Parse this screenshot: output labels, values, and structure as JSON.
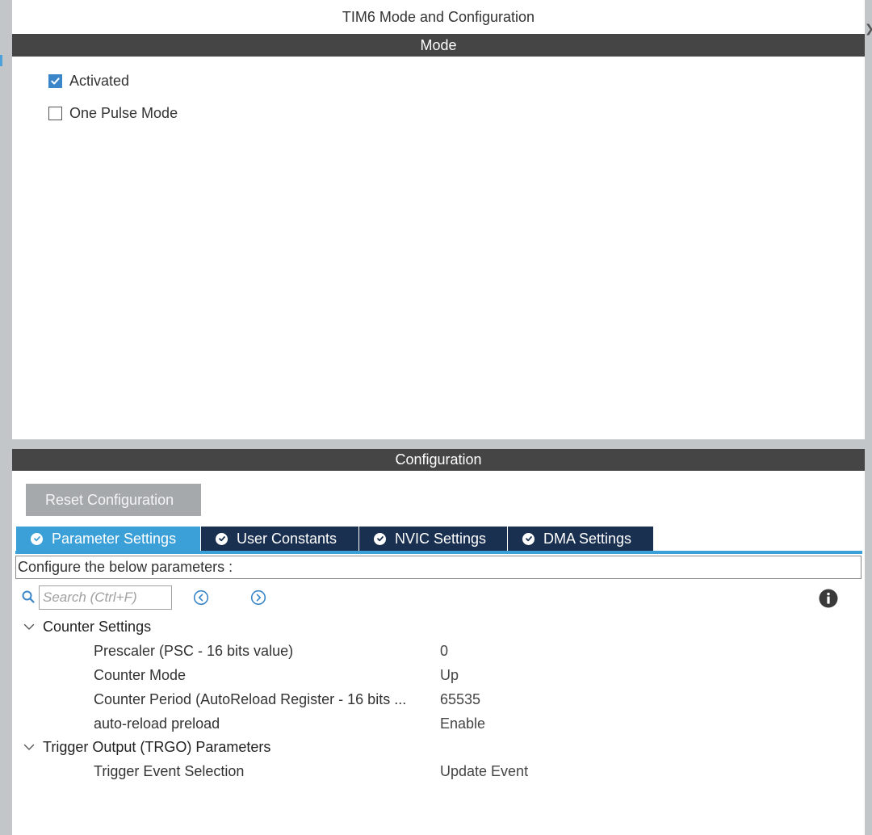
{
  "panel": {
    "title": "TIM6 Mode and Configuration"
  },
  "mode": {
    "header": "Mode",
    "activated": {
      "label": "Activated",
      "checked": true
    },
    "one_pulse": {
      "label": "One Pulse Mode",
      "checked": false
    }
  },
  "config": {
    "header": "Configuration",
    "reset_label": "Reset Configuration",
    "tabs": [
      {
        "label": "Parameter Settings",
        "active": true
      },
      {
        "label": "User Constants",
        "active": false
      },
      {
        "label": "NVIC Settings",
        "active": false
      },
      {
        "label": "DMA Settings",
        "active": false
      }
    ],
    "hint": "Configure the below parameters :",
    "search": {
      "placeholder": "Search (Ctrl+F)",
      "value": ""
    },
    "groups": [
      {
        "label": "Counter Settings",
        "params": [
          {
            "name": "Prescaler (PSC - 16 bits value)",
            "value": "0"
          },
          {
            "name": "Counter Mode",
            "value": "Up"
          },
          {
            "name": "Counter Period (AutoReload Register - 16 bits ...",
            "value": "65535"
          },
          {
            "name": "auto-reload preload",
            "value": "Enable"
          }
        ]
      },
      {
        "label": "Trigger Output (TRGO) Parameters",
        "params": [
          {
            "name": "Trigger Event Selection",
            "value": "Update Event"
          }
        ]
      }
    ]
  },
  "colors": {
    "section_bar": "#454545",
    "tab_active": "#3ba0d8",
    "tab_inactive": "#1a3050",
    "checkbox_checked": "#3a86c8",
    "reset_button": "#a6a9ac"
  },
  "icons": {
    "search": "search-icon",
    "prev": "chevron-left-circle-icon",
    "next": "chevron-right-circle-icon",
    "info": "info-icon",
    "tab_ok": "check-circle-icon",
    "expand": "chevron-down-icon"
  }
}
